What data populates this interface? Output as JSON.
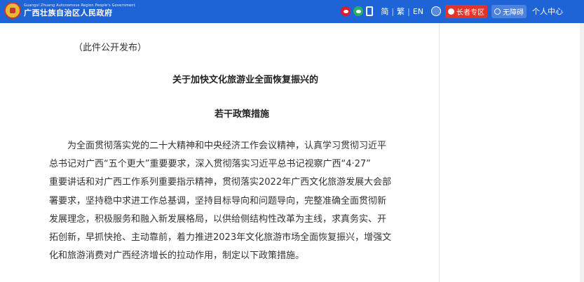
{
  "header": {
    "site_name": "广西壮族自治区人民政府",
    "site_name_en": "Guangxi Zhuang Autonomous Region People's Government",
    "lang_simplified": "简",
    "lang_traditional": "繁",
    "lang_english": "EN",
    "separator": "|",
    "elder_mode": "长者专区",
    "accessibility": "无障碍",
    "user_center": "个人中心",
    "colors": {
      "bar": "#1f64d6",
      "elder": "#e0352b"
    }
  },
  "article": {
    "notice": "（此件公开发布）",
    "title_line1": "关于加快文化旅游业全面恢复振兴的",
    "title_line2": "若干政策措施",
    "body_lines": [
      "为全面贯彻落实党的二十大精神和中央经济工作会议精神，认真学习贯彻习近平",
      "总书记对广西“五个更大”重要要求，深入贯彻落实习近平总书记视察广西“4·27”",
      "重要讲话和对广西工作系列重要指示精神，贯彻落实2022年广西文化旅游发展大会部",
      "署要求，坚持稳中求进工作总基调，坚持目标导向和问题导向，完整准确全面贯彻新",
      "发展理念，积极服务和融入新发展格局，以供给侧结构性改革为主线，求真务实、开",
      "拓创新，早抓快抢、主动靠前，着力推进2023年文化旅游市场全面恢复振兴，增强文",
      "化和旅游消费对广西经济增长的拉动作用，制定以下政策措施。"
    ]
  }
}
